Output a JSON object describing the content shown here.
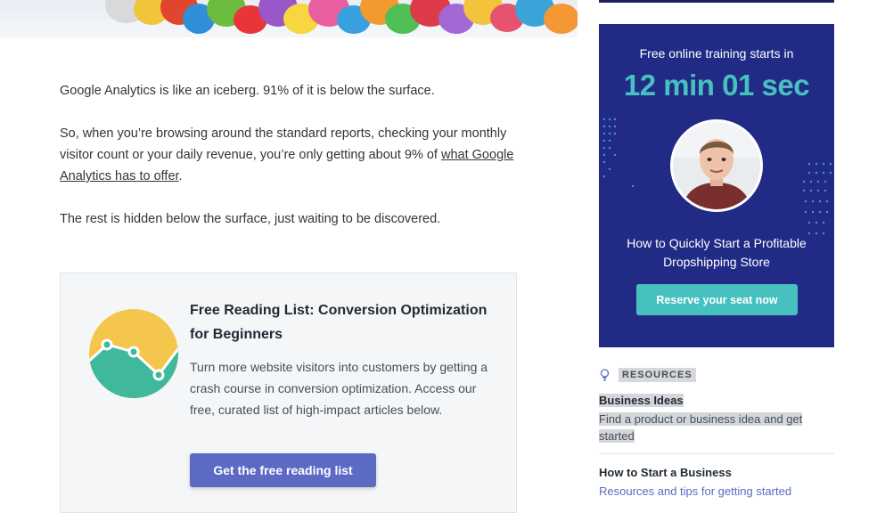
{
  "article": {
    "p1": "Google Analytics is like an iceberg. 91% of it is below the surface.",
    "p2_text": "So, when you’re browsing around the standard reports, checking your monthly visitor count or your daily revenue, you’re only getting about 9% of ",
    "p2_link": "what Google Analytics has to offer",
    "p2_end": ".",
    "p3": "The rest is hidden below the surface, just waiting to be discovered."
  },
  "reading_card": {
    "title": "Free Reading List: Conversion Optimization for Beginners",
    "description": "Turn more website visitors into customers by getting a crash course in conversion optimization. Access our free, curated list of high-impact articles below.",
    "button_label": "Get the free reading list",
    "chart_icon": "conversion-chart-icon",
    "colors": {
      "yellow": "#f5c64c",
      "teal": "#3fb89b",
      "button": "#5c6ac4"
    }
  },
  "promo": {
    "heading": "Free online training starts in",
    "timer": "12 min 01 sec",
    "subtitle": "How to Quickly Start a Profitable Dropshipping Store",
    "button_label": "Reserve your seat now",
    "colors": {
      "background": "#212b86",
      "accent": "#47c1bf"
    }
  },
  "resources": {
    "icon": "lightbulb-icon",
    "label": "RESOURCES",
    "items": [
      {
        "title": "Business Ideas",
        "description": "Find a product or business idea and get started"
      },
      {
        "title": "How to Start a Business",
        "description": "Resources and tips for getting started"
      }
    ]
  }
}
